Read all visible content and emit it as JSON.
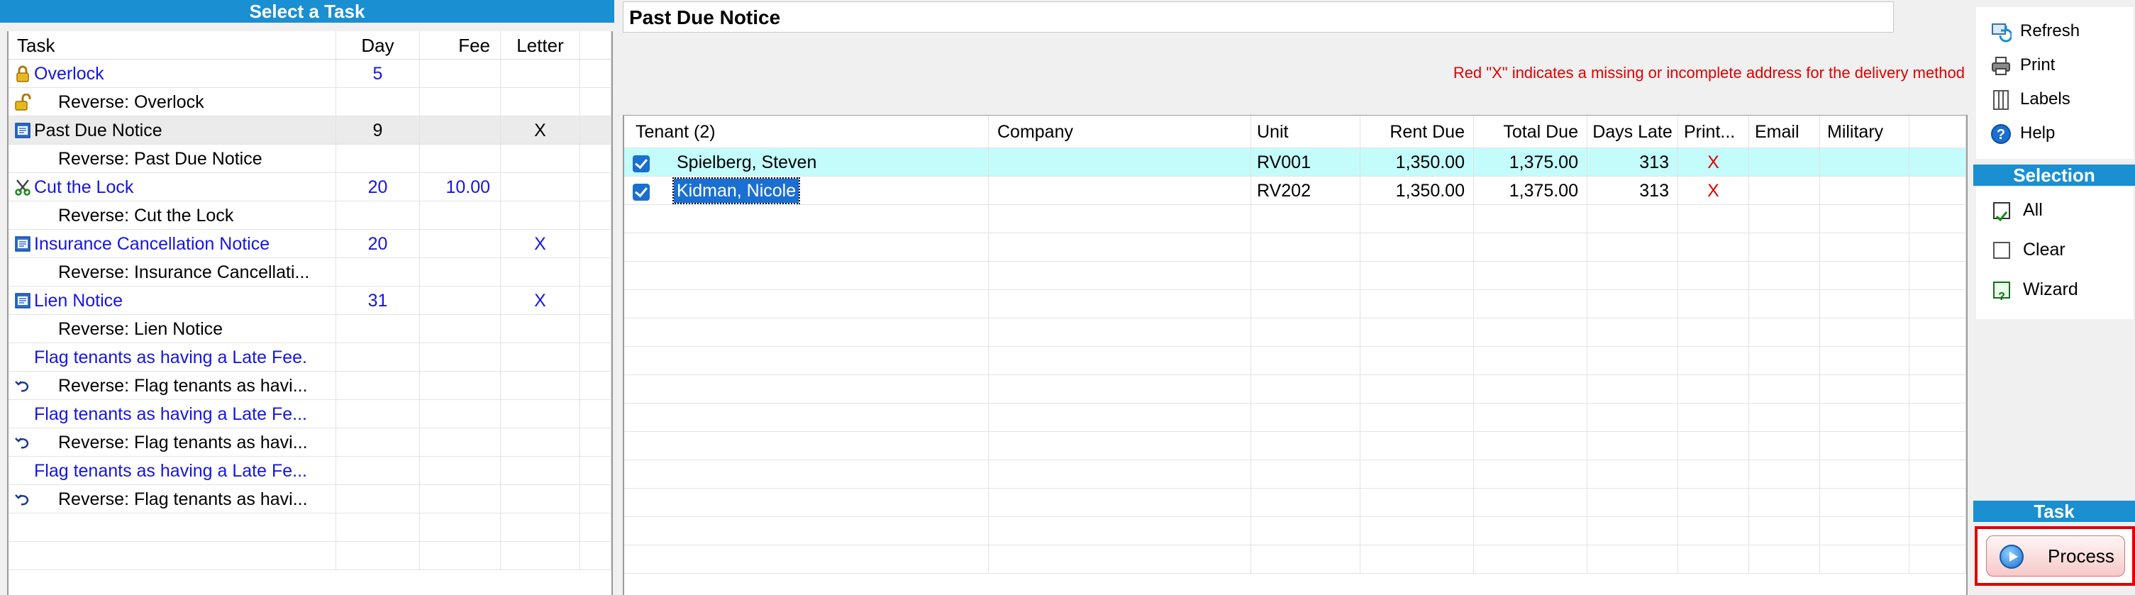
{
  "left_panel": {
    "header": "Select a Task",
    "columns": {
      "task": "Task",
      "day": "Day",
      "fee": "Fee",
      "letter": "Letter"
    },
    "rows": [
      {
        "task": "Overlock",
        "day": "5",
        "fee": "",
        "letter": "",
        "style": "blue",
        "icon": "padlock-icon"
      },
      {
        "task": "Reverse: Overlock",
        "day": "",
        "fee": "",
        "letter": "",
        "style": "indent",
        "icon": "unlock-icon"
      },
      {
        "task": "Past Due Notice",
        "day": "9",
        "fee": "",
        "letter": "X",
        "style": "black",
        "icon": "document-icon",
        "selected": true
      },
      {
        "task": "Reverse: Past Due Notice",
        "day": "",
        "fee": "",
        "letter": "",
        "style": "indent",
        "icon": ""
      },
      {
        "task": "Cut the Lock",
        "day": "20",
        "fee": "10.00",
        "letter": "",
        "style": "blue",
        "icon": "scissors-icon"
      },
      {
        "task": "Reverse: Cut the Lock",
        "day": "",
        "fee": "",
        "letter": "",
        "style": "indent",
        "icon": ""
      },
      {
        "task": "Insurance Cancellation Notice",
        "day": "20",
        "fee": "",
        "letter": "X",
        "style": "blue",
        "icon": "document-icon"
      },
      {
        "task": "Reverse: Insurance Cancellati...",
        "day": "",
        "fee": "",
        "letter": "",
        "style": "indent",
        "icon": ""
      },
      {
        "task": "Lien Notice",
        "day": "31",
        "fee": "",
        "letter": "X",
        "style": "blue",
        "icon": "document-icon"
      },
      {
        "task": "Reverse: Lien Notice",
        "day": "",
        "fee": "",
        "letter": "",
        "style": "indent",
        "icon": ""
      },
      {
        "task": "Flag tenants as having a Late Fee.",
        "day": "",
        "fee": "",
        "letter": "",
        "style": "blue-flag",
        "icon": ""
      },
      {
        "task": "Reverse: Flag tenants as havi...",
        "day": "",
        "fee": "",
        "letter": "",
        "style": "indent",
        "icon": "undo-icon"
      },
      {
        "task": "Flag tenants as having a Late Fe...",
        "day": "",
        "fee": "",
        "letter": "",
        "style": "blue-flag",
        "icon": ""
      },
      {
        "task": "Reverse: Flag tenants as havi...",
        "day": "",
        "fee": "",
        "letter": "",
        "style": "indent",
        "icon": "undo-icon"
      },
      {
        "task": "Flag tenants as having a Late Fe...",
        "day": "",
        "fee": "",
        "letter": "",
        "style": "blue-flag",
        "icon": ""
      },
      {
        "task": "Reverse: Flag tenants as havi...",
        "day": "",
        "fee": "",
        "letter": "",
        "style": "indent",
        "icon": "undo-icon"
      }
    ]
  },
  "center_panel": {
    "title": "Past Due Notice",
    "notice": "Red \"X\" indicates a missing or incomplete address for the delivery method",
    "columns": {
      "tenant": "Tenant (2)",
      "company": "Company",
      "unit": "Unit",
      "rent_due": "Rent Due",
      "total_due": "Total Due",
      "days_late": "Days Late",
      "print": "Print...",
      "email": "Email",
      "military": "Military"
    },
    "rows": [
      {
        "tenant": "Spielberg, Steven",
        "company": "",
        "unit": "RV001",
        "rent_due": "1,350.00",
        "total_due": "1,375.00",
        "days_late": "313",
        "print": "X",
        "email": "",
        "military": "",
        "checked": true,
        "active": true
      },
      {
        "tenant": "Kidman, Nicole",
        "company": "",
        "unit": "RV202",
        "rent_due": "1,350.00",
        "total_due": "1,375.00",
        "days_late": "313",
        "print": "X",
        "email": "",
        "military": "",
        "checked": true,
        "focused": true
      }
    ]
  },
  "right_panel": {
    "toolbar": [
      {
        "label": "Refresh",
        "icon": "refresh-icon"
      },
      {
        "label": "Print",
        "icon": "printer-icon"
      },
      {
        "label": "Labels",
        "icon": "labels-icon"
      },
      {
        "label": "Help",
        "icon": "help-icon"
      }
    ],
    "selection_header": "Selection",
    "selection": [
      {
        "label": "All",
        "icon": "checkbox-checked-icon"
      },
      {
        "label": "Clear",
        "icon": "checkbox-empty-icon"
      },
      {
        "label": "Wizard",
        "icon": "wizard-icon"
      }
    ],
    "task_header": "Task",
    "process_label": "Process"
  },
  "colors": {
    "header_blue": "#1a8fd1",
    "link_blue": "#1515e6",
    "error_red": "#e00000",
    "active_row": "#c4fcfc",
    "checkbox_blue": "#1a6fd1"
  }
}
